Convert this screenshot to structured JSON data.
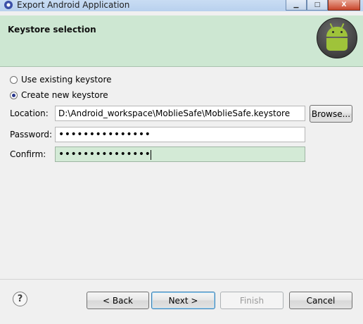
{
  "window": {
    "title": "Export Android Application",
    "min_glyph": "▁",
    "max_glyph": "□",
    "close_glyph": "X"
  },
  "header": {
    "title": "Keystore selection",
    "icon": "android-icon"
  },
  "options": [
    {
      "label": "Use existing keystore",
      "selected": false
    },
    {
      "label": "Create new keystore",
      "selected": true
    }
  ],
  "form": {
    "location_label": "Location:",
    "location_value": "D:\\Android_workspace\\MoblieSafe\\MoblieSafe.keystore",
    "browse_label": "Browse...",
    "password_label": "Password:",
    "password_value": "•••••••••••••••",
    "confirm_label": "Confirm:",
    "confirm_value": "•••••••••••••••"
  },
  "buttons": {
    "back": "< Back",
    "next": "Next >",
    "finish": "Finish",
    "cancel": "Cancel",
    "help": "?"
  },
  "colors": {
    "header_bg": "#cde7d2",
    "active_field": "#d3ead6"
  }
}
